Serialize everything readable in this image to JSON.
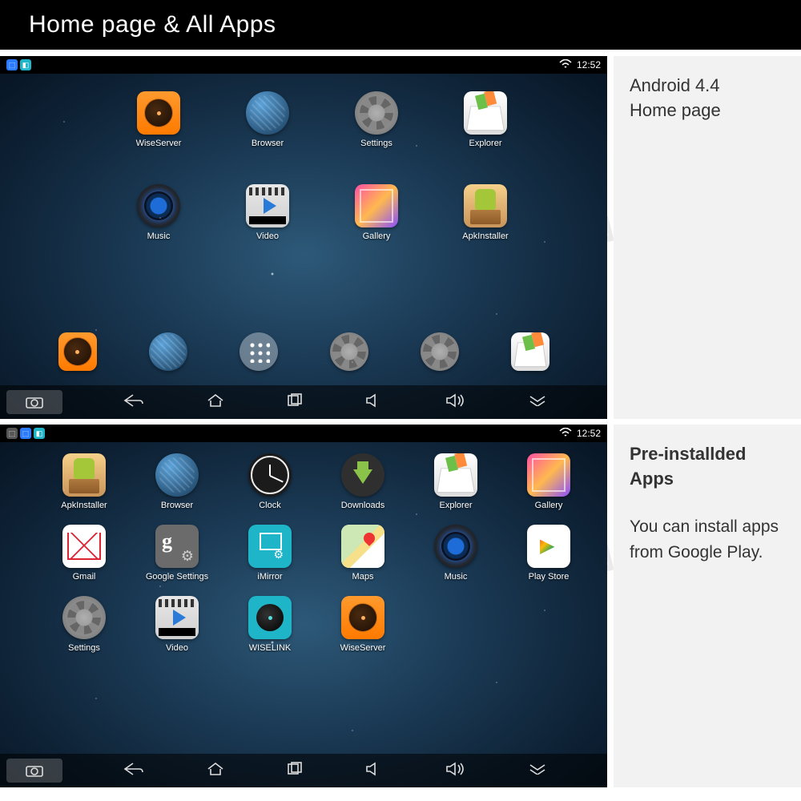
{
  "header": {
    "title": "Home page & All Apps"
  },
  "status": {
    "time": "12:52"
  },
  "watermark": "ER ELECTRONICS",
  "captions": {
    "home": {
      "line1": "Android 4.4",
      "line2": "Home page"
    },
    "apps": {
      "title": "Pre-installded Apps",
      "body": "You can install apps from Google Play."
    }
  },
  "home": {
    "row1": [
      {
        "name": "WiseServer",
        "icon": "wiseserver"
      },
      {
        "name": "Browser",
        "icon": "browser"
      },
      {
        "name": "Settings",
        "icon": "settings"
      },
      {
        "name": "Explorer",
        "icon": "explorer"
      }
    ],
    "row2": [
      {
        "name": "Music",
        "icon": "music"
      },
      {
        "name": "Video",
        "icon": "video"
      },
      {
        "name": "Gallery",
        "icon": "gallery"
      },
      {
        "name": "ApkInstaller",
        "icon": "apkinstaller"
      }
    ],
    "dock": [
      {
        "icon": "wiseserver"
      },
      {
        "icon": "browser"
      },
      {
        "icon": "appdrawer"
      },
      {
        "icon": "settings"
      },
      {
        "icon": "settings"
      },
      {
        "icon": "explorer"
      }
    ]
  },
  "apps": [
    {
      "name": "ApkInstaller",
      "icon": "apkinstaller"
    },
    {
      "name": "Browser",
      "icon": "browser"
    },
    {
      "name": "Clock",
      "icon": "clock"
    },
    {
      "name": "Downloads",
      "icon": "downloads"
    },
    {
      "name": "Explorer",
      "icon": "explorer"
    },
    {
      "name": "Gallery",
      "icon": "gallery"
    },
    {
      "name": "Gmail",
      "icon": "gmail"
    },
    {
      "name": "Google Settings",
      "icon": "gsettings"
    },
    {
      "name": "iMirror",
      "icon": "imirror"
    },
    {
      "name": "Maps",
      "icon": "maps"
    },
    {
      "name": "Music",
      "icon": "music"
    },
    {
      "name": "Play Store",
      "icon": "playstore"
    },
    {
      "name": "Settings",
      "icon": "settings"
    },
    {
      "name": "Video",
      "icon": "video"
    },
    {
      "name": "WISELINK",
      "icon": "wiselink"
    },
    {
      "name": "WiseServer",
      "icon": "wiseserver"
    }
  ],
  "nav": [
    "camera",
    "back",
    "home",
    "recent",
    "vol-down",
    "vol-up",
    "hide"
  ]
}
